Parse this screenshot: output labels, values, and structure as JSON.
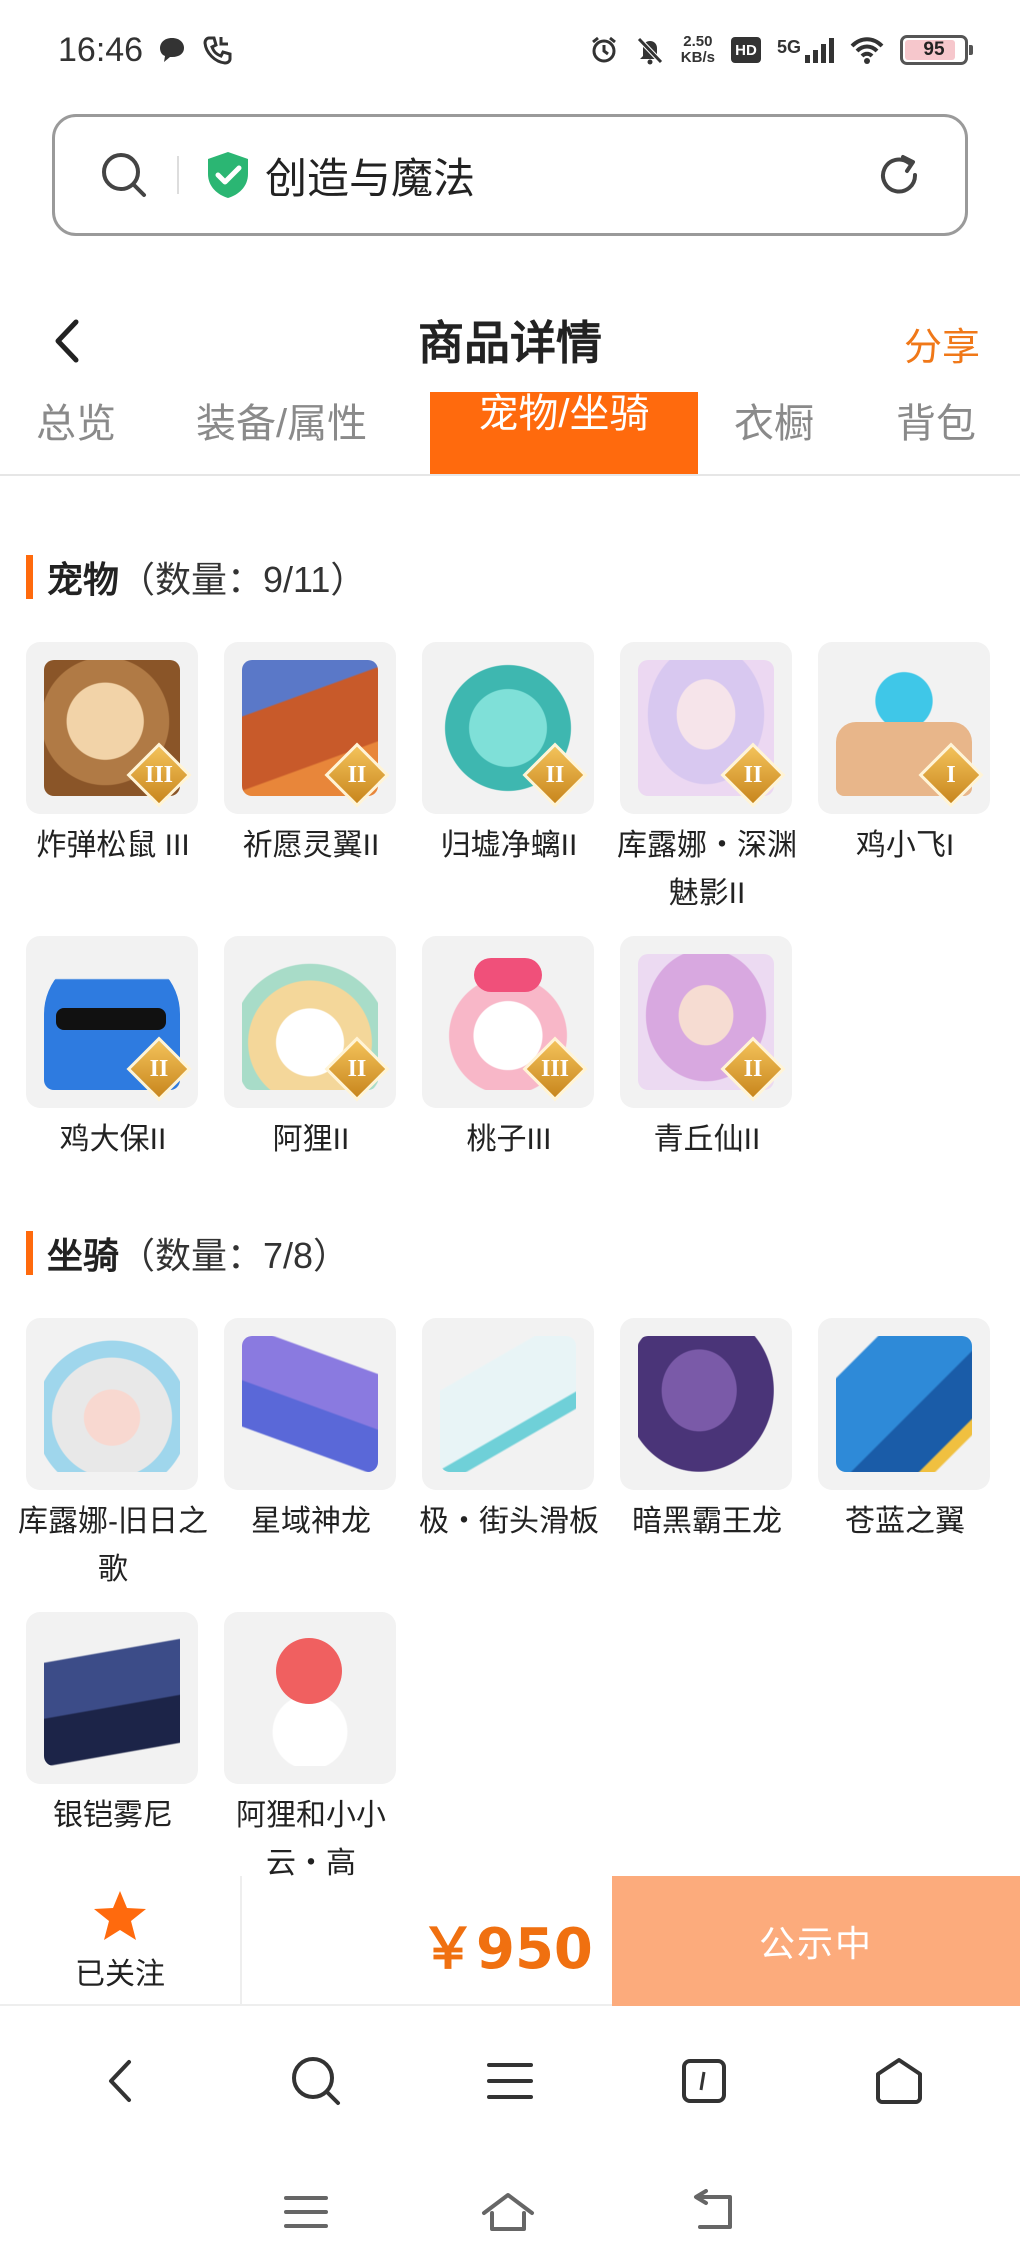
{
  "status_bar": {
    "time": "16:46",
    "net_speed_value": "2.50",
    "net_speed_unit": "KB/s",
    "hd": "HD",
    "signal": "5G",
    "battery": "95"
  },
  "search": {
    "text": "创造与魔法"
  },
  "header": {
    "title": "商品详情",
    "share": "分享"
  },
  "tabs": [
    {
      "label": "总览"
    },
    {
      "label": "装备/属性"
    },
    {
      "label": "宠物/坐骑"
    },
    {
      "label": "衣橱"
    },
    {
      "label": "背包"
    }
  ],
  "pets": {
    "title": "宠物",
    "count": "（数量：9/11）",
    "items": [
      {
        "name": "炸弹松鼠 III",
        "rank": "III"
      },
      {
        "name": "祈愿灵翼II",
        "rank": "II"
      },
      {
        "name": "归墟净螭II",
        "rank": "II"
      },
      {
        "name": "库露娜・深渊魅影II",
        "rank": "II"
      },
      {
        "name": "鸡小飞I",
        "rank": "I"
      },
      {
        "name": "鸡大保II",
        "rank": "II"
      },
      {
        "name": "阿狸II",
        "rank": "II"
      },
      {
        "name": "桃子III",
        "rank": "III"
      },
      {
        "name": "青丘仙II",
        "rank": "II"
      }
    ]
  },
  "mounts": {
    "title": "坐骑",
    "count": "（数量：7/8）",
    "items": [
      {
        "name": "库露娜-旧日之歌"
      },
      {
        "name": "星域神龙"
      },
      {
        "name": "极・街头滑板"
      },
      {
        "name": "暗黑霸王龙"
      },
      {
        "name": "苍蓝之翼"
      },
      {
        "name": "银铠雾尼"
      },
      {
        "name": "阿狸和小小云・高"
      }
    ]
  },
  "action_bar": {
    "follow_label": "已关注",
    "price": "￥950",
    "status_label": "公示中"
  },
  "colors": {
    "accent": "#ff6a0d",
    "price": "#f07010",
    "status_button": "#fcab7c",
    "rank_badge": "#d9a032"
  }
}
